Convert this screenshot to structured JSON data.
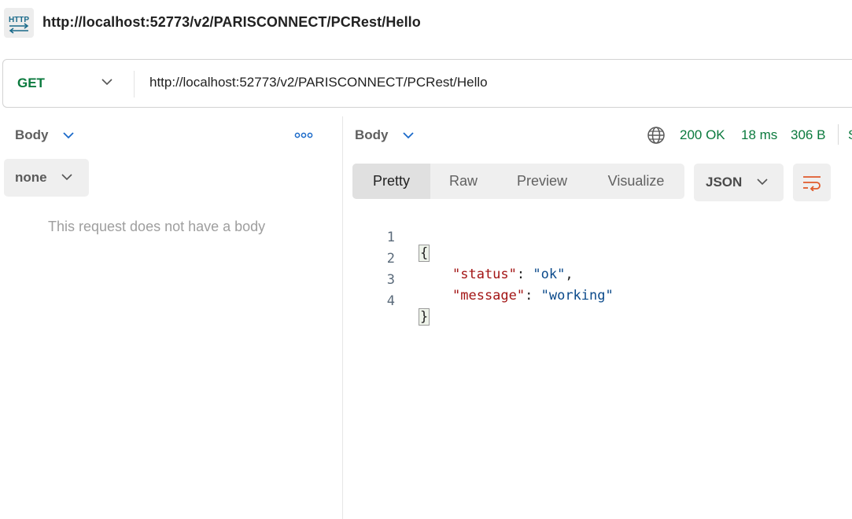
{
  "header": {
    "icon": "http-request-icon",
    "icon_text": "HTTP",
    "title": "http://localhost:52773/v2/PARISCONNECT/PCRest/Hello"
  },
  "request": {
    "method": "GET",
    "url": "http://localhost:52773/v2/PARISCONNECT/PCRest/Hello"
  },
  "request_panel": {
    "section_label": "Body",
    "body_type": "none",
    "empty_message": "This request does not have a body"
  },
  "response_panel": {
    "section_label": "Body",
    "status": "200 OK",
    "time": "18 ms",
    "size": "306 B",
    "cut_text": "S",
    "tabs": [
      {
        "label": "Pretty",
        "active": true
      },
      {
        "label": "Raw",
        "active": false
      },
      {
        "label": "Preview",
        "active": false
      },
      {
        "label": "Visualize",
        "active": false
      }
    ],
    "format": "JSON",
    "code_lines": [
      {
        "num": "1",
        "open": "{"
      },
      {
        "num": "2",
        "key": "\"status\"",
        "sep": ": ",
        "value": "\"ok\"",
        "end": ","
      },
      {
        "num": "3",
        "key": "\"message\"",
        "sep": ": ",
        "value": "\"working\"",
        "end": ""
      },
      {
        "num": "4",
        "close": "}"
      }
    ]
  },
  "colors": {
    "success": "#0b7a3e",
    "accent": "#e05a2b",
    "json_key": "#a31515",
    "json_value": "#0b4a8b"
  }
}
